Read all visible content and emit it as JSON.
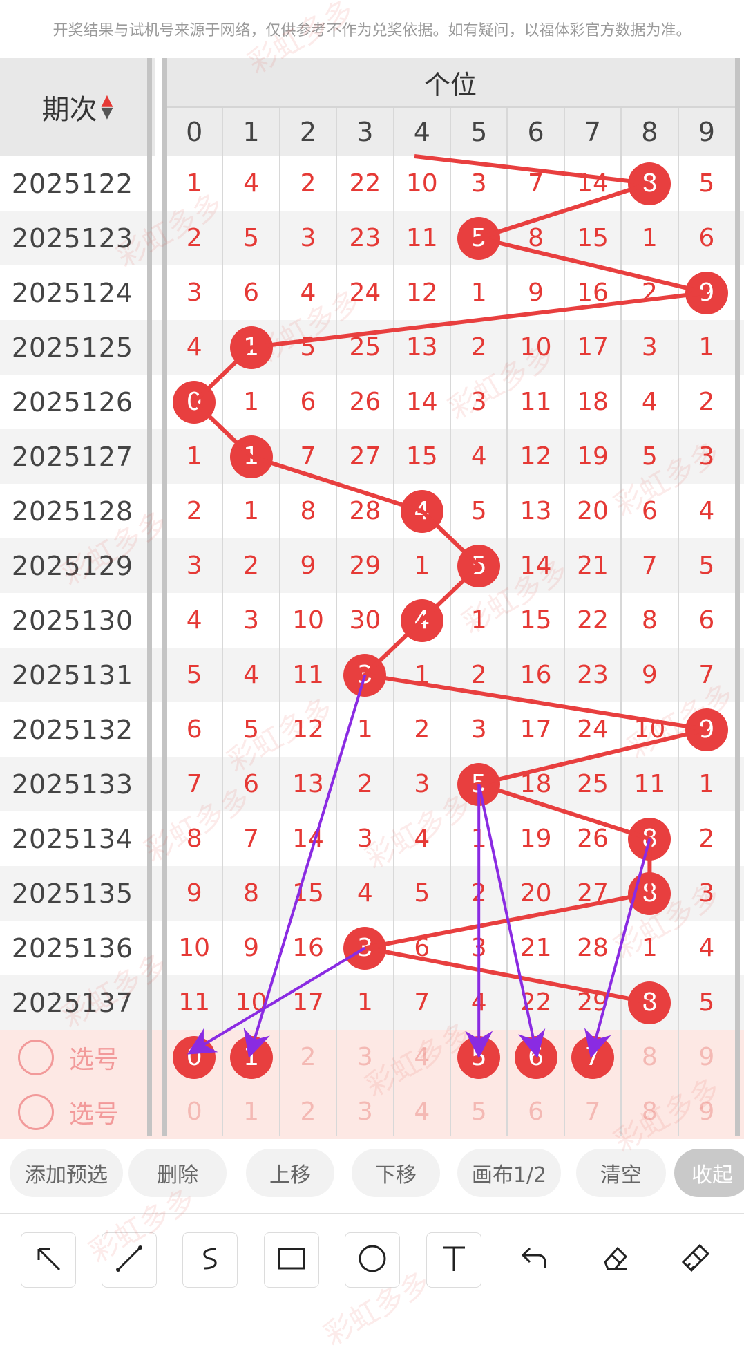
{
  "notice": "开奖结果与试机号来源于网络，仅供参考不作为兑奖依据。如有疑问，以福体彩官方数据为准。",
  "table": {
    "period_header": "期次",
    "group_header": "个位",
    "digit_headers": [
      "0",
      "1",
      "2",
      "3",
      "4",
      "5",
      "6",
      "7",
      "8",
      "9"
    ],
    "rows": [
      {
        "period": "2025122",
        "cells": [
          "1",
          "4",
          "2",
          "22",
          "10",
          "3",
          "7",
          "14",
          "8",
          "5"
        ],
        "hit": 8
      },
      {
        "period": "2025123",
        "cells": [
          "2",
          "5",
          "3",
          "23",
          "11",
          "5",
          "8",
          "15",
          "1",
          "6"
        ],
        "hit": 5
      },
      {
        "period": "2025124",
        "cells": [
          "3",
          "6",
          "4",
          "24",
          "12",
          "1",
          "9",
          "16",
          "2",
          "9"
        ],
        "hit": 9
      },
      {
        "period": "2025125",
        "cells": [
          "4",
          "1",
          "5",
          "25",
          "13",
          "2",
          "10",
          "17",
          "3",
          "1"
        ],
        "hit": 1
      },
      {
        "period": "2025126",
        "cells": [
          "0",
          "1",
          "6",
          "26",
          "14",
          "3",
          "11",
          "18",
          "4",
          "2"
        ],
        "hit": 0
      },
      {
        "period": "2025127",
        "cells": [
          "1",
          "1",
          "7",
          "27",
          "15",
          "4",
          "12",
          "19",
          "5",
          "3"
        ],
        "hit": 1
      },
      {
        "period": "2025128",
        "cells": [
          "2",
          "1",
          "8",
          "28",
          "4",
          "5",
          "13",
          "20",
          "6",
          "4"
        ],
        "hit": 4
      },
      {
        "period": "2025129",
        "cells": [
          "3",
          "2",
          "9",
          "29",
          "1",
          "5",
          "14",
          "21",
          "7",
          "5"
        ],
        "hit": 5
      },
      {
        "period": "2025130",
        "cells": [
          "4",
          "3",
          "10",
          "30",
          "4",
          "1",
          "15",
          "22",
          "8",
          "6"
        ],
        "hit": 4
      },
      {
        "period": "2025131",
        "cells": [
          "5",
          "4",
          "11",
          "3",
          "1",
          "2",
          "16",
          "23",
          "9",
          "7"
        ],
        "hit": 3
      },
      {
        "period": "2025132",
        "cells": [
          "6",
          "5",
          "12",
          "1",
          "2",
          "3",
          "17",
          "24",
          "10",
          "9"
        ],
        "hit": 9
      },
      {
        "period": "2025133",
        "cells": [
          "7",
          "6",
          "13",
          "2",
          "3",
          "5",
          "18",
          "25",
          "11",
          "1"
        ],
        "hit": 5
      },
      {
        "period": "2025134",
        "cells": [
          "8",
          "7",
          "14",
          "3",
          "4",
          "1",
          "19",
          "26",
          "8",
          "2"
        ],
        "hit": 8
      },
      {
        "period": "2025135",
        "cells": [
          "9",
          "8",
          "15",
          "4",
          "5",
          "2",
          "20",
          "27",
          "8",
          "3"
        ],
        "hit": 8
      },
      {
        "period": "2025136",
        "cells": [
          "10",
          "9",
          "16",
          "3",
          "6",
          "3",
          "21",
          "28",
          "1",
          "4"
        ],
        "hit": 3
      },
      {
        "period": "2025137",
        "cells": [
          "11",
          "10",
          "17",
          "1",
          "7",
          "4",
          "22",
          "29",
          "8",
          "5"
        ],
        "hit": 8
      }
    ],
    "pick_rows": [
      {
        "label": "选号",
        "cells": [
          "0",
          "1",
          "2",
          "3",
          "4",
          "5",
          "6",
          "7",
          "8",
          "9"
        ],
        "selected": [
          0,
          1,
          5,
          6,
          7
        ]
      },
      {
        "label": "选号",
        "cells": [
          "0",
          "1",
          "2",
          "3",
          "4",
          "5",
          "6",
          "7",
          "8",
          "9"
        ],
        "selected": []
      }
    ]
  },
  "buttons": [
    "添加预选",
    "删除",
    "上移",
    "下移",
    "画布1/2",
    "清空",
    "收起"
  ],
  "tools": [
    "arrow-tool",
    "line-tool",
    "curve-tool",
    "rectangle-tool",
    "circle-tool",
    "text-tool",
    "undo-tool",
    "eraser-tool",
    "clear-brush-tool"
  ],
  "watermark": "彩虹多多",
  "colors": {
    "accent": "#e83f3f",
    "draw": "#8a2be2"
  }
}
